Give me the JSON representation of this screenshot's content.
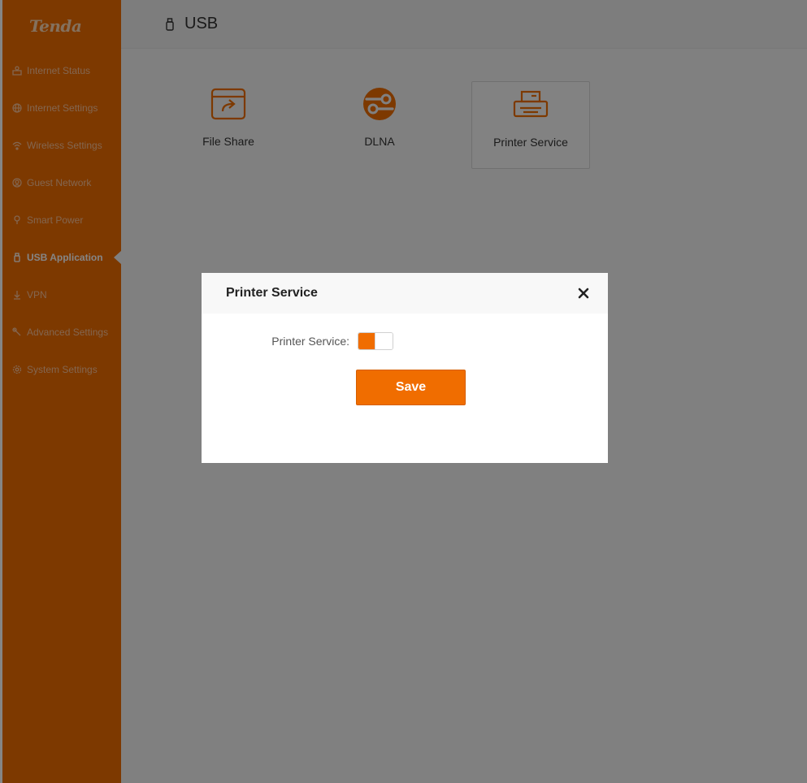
{
  "brand": {
    "logo_text": "Tenda"
  },
  "sidebar": {
    "items": [
      {
        "label": "Internet Status",
        "icon": "internet-status-icon"
      },
      {
        "label": "Internet Settings",
        "icon": "globe-icon"
      },
      {
        "label": "Wireless Settings",
        "icon": "wifi-icon"
      },
      {
        "label": "Guest Network",
        "icon": "guest-network-icon"
      },
      {
        "label": "Smart Power",
        "icon": "smart-power-icon"
      },
      {
        "label": "USB Application",
        "icon": "usb-icon",
        "active": true
      },
      {
        "label": "VPN",
        "icon": "vpn-icon"
      },
      {
        "label": "Advanced Settings",
        "icon": "wrench-icon"
      },
      {
        "label": "System Settings",
        "icon": "gear-icon"
      }
    ]
  },
  "header": {
    "title": "USB",
    "icon": "usb-icon"
  },
  "tiles": [
    {
      "label": "File Share",
      "icon": "file-share-icon"
    },
    {
      "label": "DLNA",
      "icon": "dlna-icon"
    },
    {
      "label": "Printer Service",
      "icon": "printer-icon",
      "selected": true
    }
  ],
  "modal": {
    "title": "Printer Service",
    "field_label": "Printer Service:",
    "toggle_on": true,
    "save_label": "Save"
  },
  "colors": {
    "accent": "#f06d00",
    "overlay": "rgba(0,0,0,0.48)"
  }
}
